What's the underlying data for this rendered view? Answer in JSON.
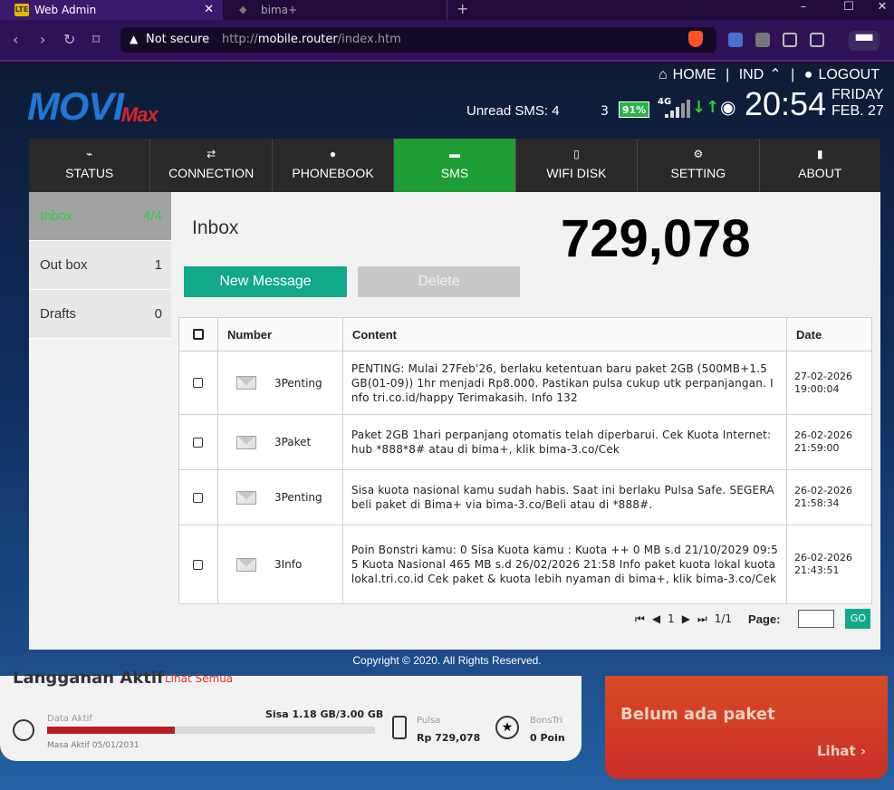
{
  "browser": {
    "active_tab": "Web Admin",
    "inactive_tab": "bima+",
    "new_tab": "+",
    "url_warning": "Not secure",
    "url_prefix": "http://",
    "url_host": "mobile.router",
    "url_path": "/index.htm",
    "tab_icon_text": "LTE",
    "window_controls": [
      "–",
      "☐",
      "✕"
    ]
  },
  "header": {
    "logo_main": "MOVI",
    "logo_sub": "Max",
    "top_nav": [
      "HOME",
      "|",
      "IND",
      "|",
      "LOGOUT"
    ],
    "unread_sms": "Unread SMS: 4",
    "count": "3",
    "battery": "91%",
    "network_type": "4G",
    "time": "20:54",
    "day": "FRIDAY",
    "date": "FEB. 27"
  },
  "nav": {
    "items": [
      {
        "label": "STATUS",
        "icon": "chart-icon"
      },
      {
        "label": "CONNECTION",
        "icon": "arrows-icon"
      },
      {
        "label": "PHONEBOOK",
        "icon": "person-icon"
      },
      {
        "label": "SMS",
        "icon": "chat-icon"
      },
      {
        "label": "WIFI DISK",
        "icon": "disk-icon"
      },
      {
        "label": "SETTING",
        "icon": "gear-icon"
      },
      {
        "label": "ABOUT",
        "icon": "info-icon"
      }
    ],
    "active": "SMS"
  },
  "sidebar": {
    "items": [
      {
        "label": "Inbox",
        "count": "4/4"
      },
      {
        "label": "Out box",
        "count": "1"
      },
      {
        "label": "Drafts",
        "count": "0"
      }
    ]
  },
  "inbox": {
    "title": "Inbox",
    "balance": "729,078",
    "new_message": "New Message",
    "delete": "Delete",
    "columns": [
      "Number",
      "Content",
      "Date"
    ],
    "rows": [
      {
        "number": "3Penting",
        "content": "PENTING: Mulai 27Feb'26, berlaku ketentuan baru paket 2GB (500MB+1.5 GB(01-09)) 1hr menjadi Rp8.000. Pastikan pulsa cukup utk perpanjangan. Info tri.co.id/happy Terimakasih. Info 132",
        "date": "27-02-2026",
        "time": "19:00:04"
      },
      {
        "number": "3Paket",
        "content": "Paket 2GB 1hari perpanjang otomatis telah diperbarui. Cek Kuota Internet: hub *888*8# atau di bima+, klik bima-3.co/Cek",
        "date": "26-02-2026",
        "time": "21:59:00"
      },
      {
        "number": "3Penting",
        "content": "Sisa kuota nasional kamu sudah habis. Saat ini berlaku Pulsa Safe. SEGERA beli paket di Bima+ via bima-3.co/Beli atau di *888#.",
        "date": "26-02-2026",
        "time": "21:58:34"
      },
      {
        "number": "3Info",
        "content": "Poin Bonstri kamu: 0 Sisa Kuota kamu : Kuota ++ 0 MB s.d 21/10/2029 09:55 Kuota Nasional 465 MB s.d 26/02/2026 21:58 Info paket kuota lokal kuotalokal.tri.co.id Cek paket & kuota lebih nyaman di bima+, klik bima-3.co/Cek",
        "date": "26-02-2026",
        "time": "21:43:51"
      }
    ],
    "pager": {
      "current": "1",
      "total": "1/1",
      "page_label": "Page:",
      "go": "GO"
    }
  },
  "footer": {
    "copyright": "Copyright © 2020. All Rights Reserved."
  },
  "underlying": {
    "title": "Langganan Aktif",
    "link": "Lihat Semua",
    "data_label": "Data Aktif",
    "data_remaining": "Sisa 1.18 GB/3.00 GB",
    "data_used_fraction": 0.39,
    "masa_aktif": "Masa Aktif 05/01/2031",
    "pulsa_label": "Pulsa",
    "pulsa_value": "Rp 729,078",
    "bonstri_label": "BonsTri",
    "bonstri_value": "0 Poin",
    "right_title": "Belum ada paket",
    "right_link": "Lihat ›"
  },
  "colors": {
    "accent_green": "#1f9d35",
    "button_teal": "#11a988",
    "nav_dark": "#292929"
  }
}
